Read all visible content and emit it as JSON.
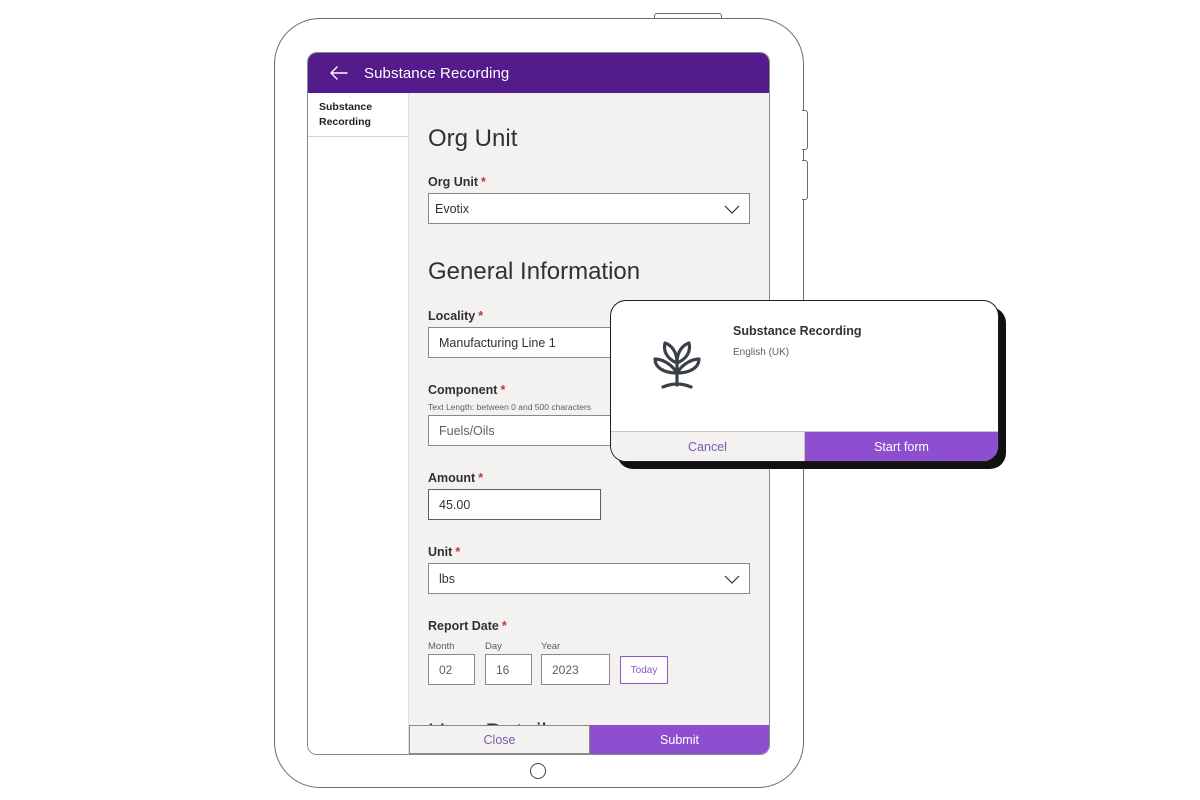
{
  "app": {
    "title": "Substance Recording",
    "back_icon": "arrow-left-icon",
    "header_color": "#531b8b"
  },
  "nav": {
    "items": [
      {
        "label": "Substance Recording"
      }
    ]
  },
  "form": {
    "org_unit_section": "Org Unit",
    "org_unit": {
      "label": "Org Unit",
      "required": "*",
      "value": "Evotix"
    },
    "general_section": "General Information",
    "locality": {
      "label": "Locality",
      "required": "*",
      "value": "Manufacturing Line 1"
    },
    "component": {
      "label": "Component",
      "required": "*",
      "hint": "Text Length: between 0 and 500 characters",
      "value": "Fuels/Oils"
    },
    "amount": {
      "label": "Amount",
      "required": "*",
      "value": "45.00"
    },
    "unit": {
      "label": "Unit",
      "required": "*",
      "value": "lbs"
    },
    "report_date": {
      "label": "Report Date",
      "required": "*",
      "month_label": "Month",
      "month": "02",
      "day_label": "Day",
      "day": "16",
      "year_label": "Year",
      "year": "2023",
      "today_label": "Today"
    },
    "next_section_partial": "User Details"
  },
  "footer": {
    "close_label": "Close",
    "submit_label": "Submit"
  },
  "popup": {
    "title": "Substance Recording",
    "language": "English (UK)",
    "icon": "plant-sprout-icon",
    "cancel_label": "Cancel",
    "start_label": "Start form",
    "accent_color": "#8d4fd0"
  }
}
